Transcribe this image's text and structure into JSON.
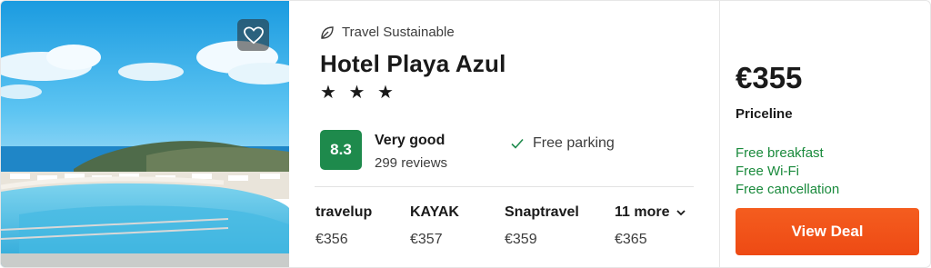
{
  "listing": {
    "sustainability_label": "Travel Sustainable",
    "hotel_name": "Hotel Playa Azul",
    "stars": "★ ★ ★",
    "star_count": 3,
    "rating": {
      "score": "8.3",
      "word": "Very good",
      "reviews": "299 reviews",
      "color": "#1e8a4c"
    },
    "amenity_highlight": "Free parking",
    "other_offers": [
      {
        "provider": "travelup",
        "price": "€356"
      },
      {
        "provider": "KAYAK",
        "price": "€357"
      },
      {
        "provider": "Snaptravel",
        "price": "€359"
      }
    ],
    "more_offers": {
      "label": "11 more",
      "price": "€365"
    },
    "best_offer": {
      "price": "€355",
      "provider": "Priceline",
      "perks": [
        "Free breakfast",
        "Free Wi-Fi",
        "Free cancellation"
      ],
      "cta": "View Deal"
    }
  },
  "icons": {
    "favorite": "heart-icon",
    "sustainable": "leaf-icon",
    "parking": "check-icon",
    "more": "chevron-down-icon"
  },
  "colors": {
    "accent": "#f2511b",
    "perk_green": "#1a8a3c",
    "score_green": "#1e8a4c"
  }
}
